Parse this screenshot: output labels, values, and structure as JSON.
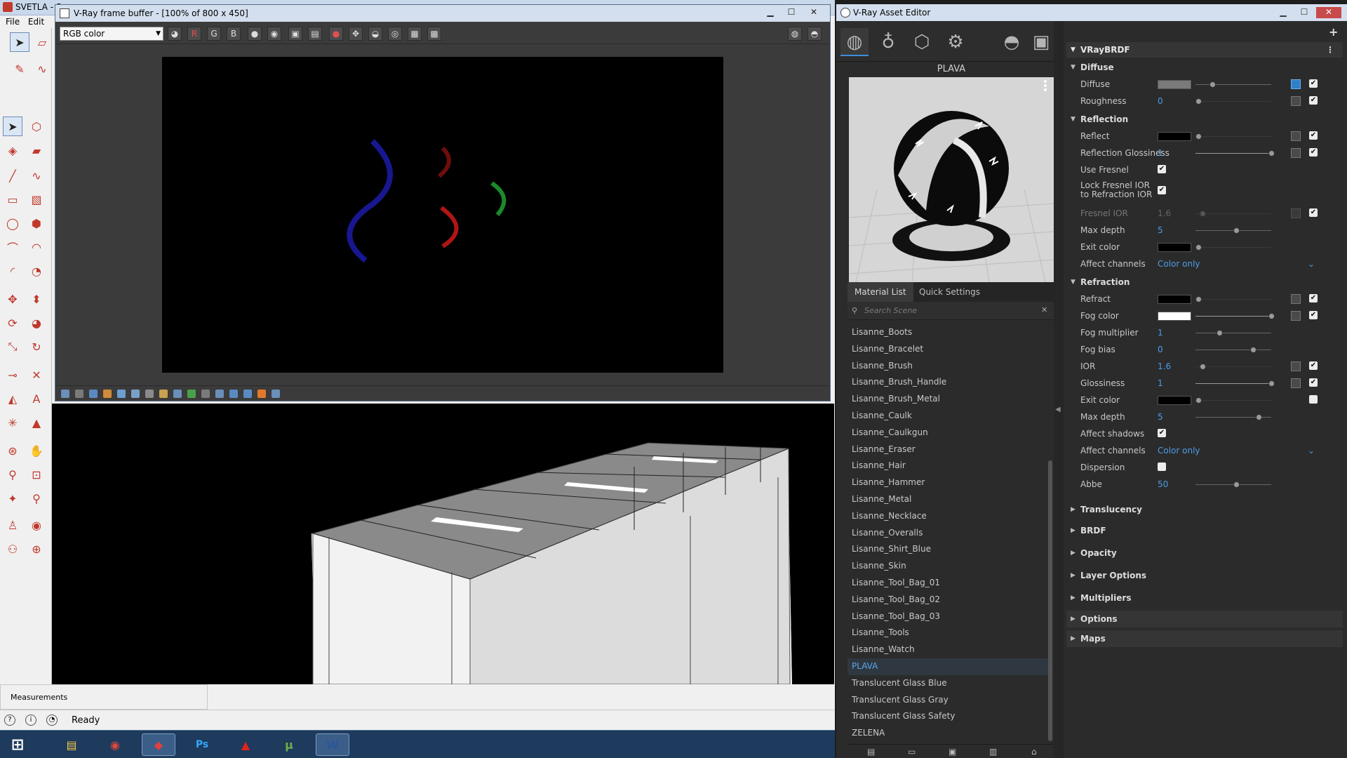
{
  "sketchup": {
    "title": "SVETLA - S",
    "menu": [
      "File",
      "Edit"
    ],
    "measurements_label": "Measurements",
    "status": "Ready"
  },
  "vfb": {
    "title": "V-Ray frame buffer - [100% of 800 x 450]",
    "channel": "RGB color",
    "buttons": {
      "r": "R",
      "g": "G",
      "b": "B"
    }
  },
  "asset_editor": {
    "title": "V-Ray Asset Editor",
    "material_name": "PLAVA",
    "tabs": {
      "material_list": "Material List",
      "quick_settings": "Quick Settings"
    },
    "search_placeholder": "Search Scene",
    "materials": [
      "Lisanne_Boots",
      "Lisanne_Bracelet",
      "Lisanne_Brush",
      "Lisanne_Brush_Handle",
      "Lisanne_Brush_Metal",
      "Lisanne_Caulk",
      "Lisanne_Caulkgun",
      "Lisanne_Eraser",
      "Lisanne_Hair",
      "Lisanne_Hammer",
      "Lisanne_Metal",
      "Lisanne_Necklace",
      "Lisanne_Overalls",
      "Lisanne_Shirt_Blue",
      "Lisanne_Skin",
      "Lisanne_Tool_Bag_01",
      "Lisanne_Tool_Bag_02",
      "Lisanne_Tool_Bag_03",
      "Lisanne_Tools",
      "Lisanne_Watch",
      "PLAVA",
      "Translucent Glass Blue",
      "Translucent Glass Gray",
      "Translucent Glass Safety",
      "ZELENA"
    ],
    "selected_material": "PLAVA",
    "brdf_header": "VRayBRDF",
    "diffuse": {
      "section": "Diffuse",
      "diffuse_label": "Diffuse",
      "diffuse_color": "#7a7a7a",
      "roughness_label": "Roughness",
      "roughness_value": "0"
    },
    "reflection": {
      "section": "Reflection",
      "reflect_label": "Reflect",
      "reflect_color": "#000000",
      "glossiness_label": "Reflection Glossiness",
      "glossiness_value": "1",
      "use_fresnel_label": "Use Fresnel",
      "lock_ior_label": "Lock Fresnel IOR to Refraction IOR",
      "fresnel_ior_label": "Fresnel IOR",
      "fresnel_ior_value": "1.6",
      "max_depth_label": "Max depth",
      "max_depth_value": "5",
      "exit_color_label": "Exit color",
      "affect_channels_label": "Affect channels",
      "affect_channels_value": "Color only"
    },
    "refraction": {
      "section": "Refraction",
      "refract_label": "Refract",
      "fog_color_label": "Fog color",
      "fog_color": "#ffffff",
      "fog_mult_label": "Fog multiplier",
      "fog_mult_value": "1",
      "fog_bias_label": "Fog bias",
      "fog_bias_value": "0",
      "ior_label": "IOR",
      "ior_value": "1.6",
      "glossiness_label": "Glossiness",
      "glossiness_value": "1",
      "exit_color_label": "Exit color",
      "max_depth_label": "Max depth",
      "max_depth_value": "5",
      "affect_shadows_label": "Affect shadows",
      "affect_channels_label": "Affect channels",
      "affect_channels_value": "Color only",
      "dispersion_label": "Dispersion",
      "abbe_label": "Abbe",
      "abbe_value": "50"
    },
    "collapsed_sections": [
      "Translucency",
      "BRDF",
      "Opacity",
      "Layer Options",
      "Multipliers",
      "Options",
      "Maps"
    ]
  },
  "colors": {
    "accent": "#4d9de8",
    "panel": "#2b2b2b"
  }
}
